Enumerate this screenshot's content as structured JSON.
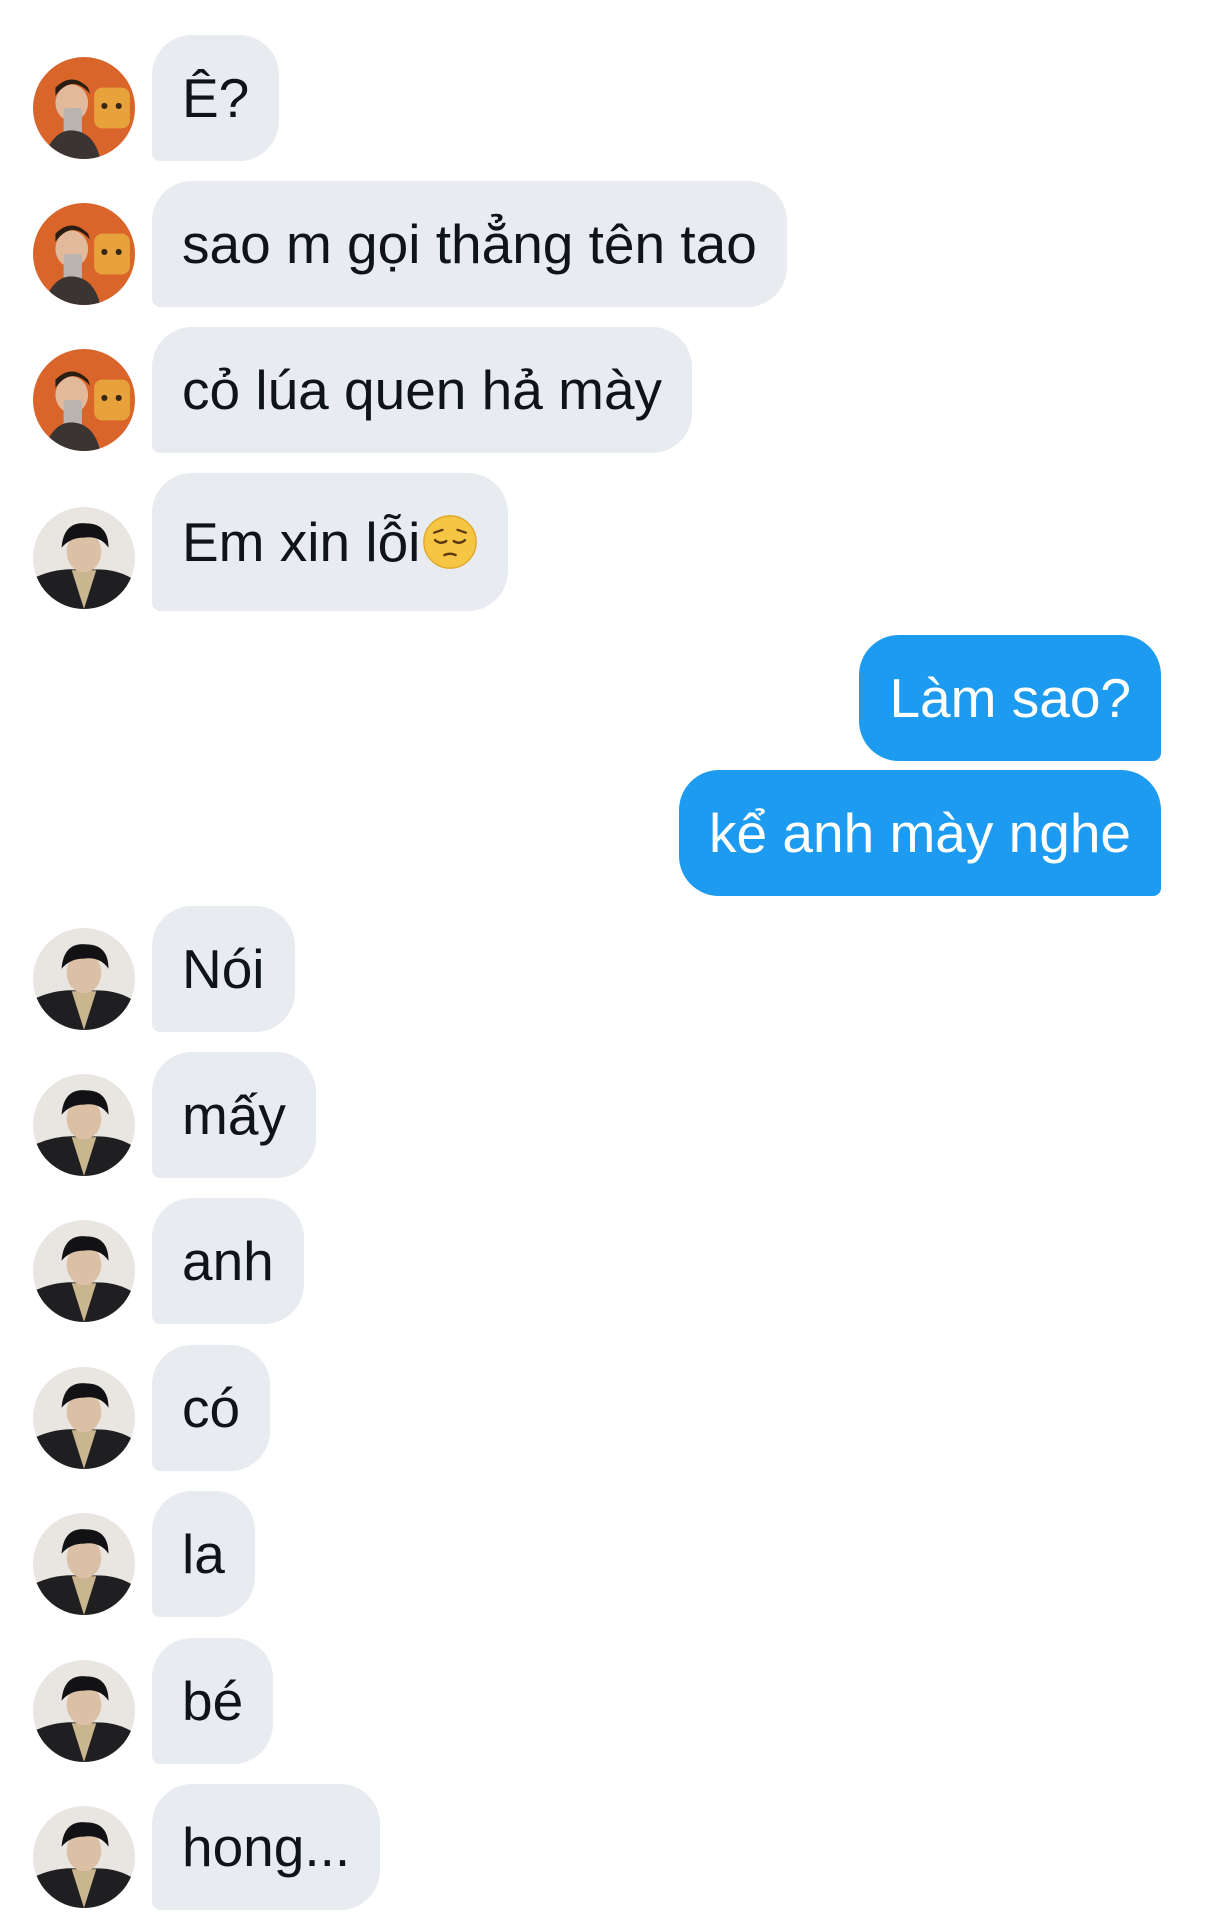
{
  "messages": [
    {
      "side": "in",
      "avatar": "avatar-orange",
      "text": "Ê?"
    },
    {
      "side": "in",
      "avatar": "avatar-orange",
      "text": "sao m gọi thẳng tên tao"
    },
    {
      "side": "in",
      "avatar": "avatar-orange",
      "text": "cỏ lúa quen hả mày"
    },
    {
      "side": "in",
      "avatar": "avatar-dark",
      "text": "Em xin lỗi",
      "emoji": "pensive-face-emoji"
    },
    {
      "side": "out",
      "text": "Làm sao?"
    },
    {
      "side": "out",
      "text": "kể anh mày nghe"
    },
    {
      "side": "in",
      "avatar": "avatar-dark",
      "text": "Nói"
    },
    {
      "side": "in",
      "avatar": "avatar-dark",
      "text": "mấy"
    },
    {
      "side": "in",
      "avatar": "avatar-dark",
      "text": "anh"
    },
    {
      "side": "in",
      "avatar": "avatar-dark",
      "text": "có"
    },
    {
      "side": "in",
      "avatar": "avatar-dark",
      "text": "la"
    },
    {
      "side": "in",
      "avatar": "avatar-dark",
      "text": "bé"
    },
    {
      "side": "in",
      "avatar": "avatar-dark",
      "text": "hong..."
    }
  ],
  "colors": {
    "incoming_bubble": "#e8ebef",
    "outgoing_bubble": "#1d9bf0",
    "incoming_text": "#0f1419",
    "outgoing_text": "#ffffff",
    "background": "#ffffff"
  }
}
